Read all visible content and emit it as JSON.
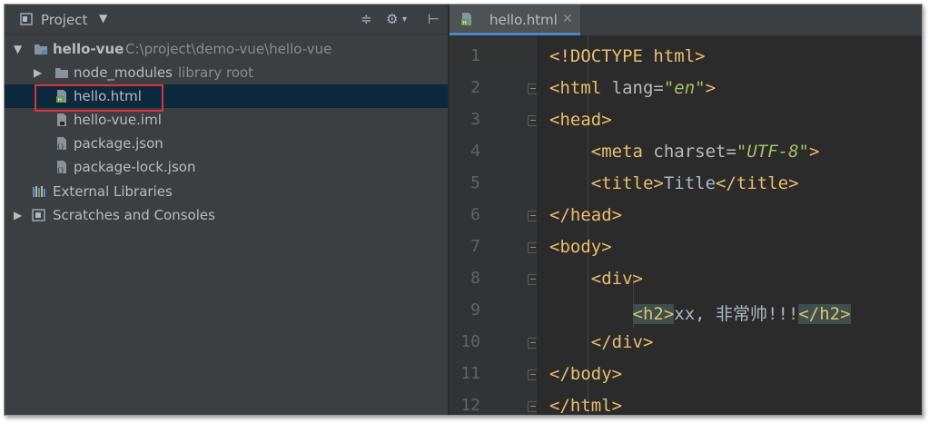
{
  "project_panel": {
    "title": "Project",
    "tree": [
      {
        "label": "hello-vue",
        "path": "C:\\project\\demo-vue\\hello-vue"
      },
      {
        "label": "node_modules",
        "path": "library root"
      },
      {
        "label": "hello.html"
      },
      {
        "label": "hello-vue.iml"
      },
      {
        "label": "package.json"
      },
      {
        "label": "package-lock.json"
      },
      {
        "label": "External Libraries"
      },
      {
        "label": "Scratches and Consoles"
      }
    ]
  },
  "editor": {
    "tab_label": "hello.html",
    "line_numbers": [
      "1",
      "2",
      "3",
      "4",
      "5",
      "6",
      "7",
      "8",
      "9",
      "10",
      "11",
      "12"
    ],
    "lines": [
      {
        "parts": [
          {
            "c": "t",
            "v": "<!DOCTYPE html>"
          }
        ]
      },
      {
        "parts": [
          {
            "c": "t",
            "v": "<html "
          },
          {
            "c": "a",
            "v": "lang="
          },
          {
            "c": "s",
            "v": "\"en\""
          },
          {
            "c": "t",
            "v": ">"
          }
        ]
      },
      {
        "parts": [
          {
            "c": "t",
            "v": "<head>"
          }
        ]
      },
      {
        "parts": [
          {
            "c": "t",
            "v": "    <meta "
          },
          {
            "c": "a",
            "v": "charset="
          },
          {
            "c": "s",
            "v": "\"UTF-8\""
          },
          {
            "c": "t",
            "v": ">"
          }
        ]
      },
      {
        "parts": [
          {
            "c": "t",
            "v": "    <title>"
          },
          {
            "c": "x",
            "v": "Title"
          },
          {
            "c": "t",
            "v": "</title>"
          }
        ]
      },
      {
        "parts": [
          {
            "c": "t",
            "v": "</head>"
          }
        ]
      },
      {
        "parts": [
          {
            "c": "t",
            "v": "<body>"
          }
        ]
      },
      {
        "parts": [
          {
            "c": "t",
            "v": "    <div>"
          }
        ]
      },
      {
        "parts": [
          {
            "c": "x",
            "v": "        "
          },
          {
            "c": "hl",
            "v": "<h2>"
          },
          {
            "c": "x",
            "v": "xx, 非常帅!!!"
          },
          {
            "c": "hl",
            "v": "</h2>"
          }
        ]
      },
      {
        "parts": [
          {
            "c": "t",
            "v": "    </div>"
          }
        ]
      },
      {
        "parts": [
          {
            "c": "t",
            "v": "</body>"
          }
        ]
      },
      {
        "parts": [
          {
            "c": "t",
            "v": "</html>"
          }
        ]
      }
    ]
  },
  "colors": {
    "accent_tab_underline": "#4a88c7",
    "selection": "#0d293e",
    "highlight_box": "#d6343a"
  }
}
